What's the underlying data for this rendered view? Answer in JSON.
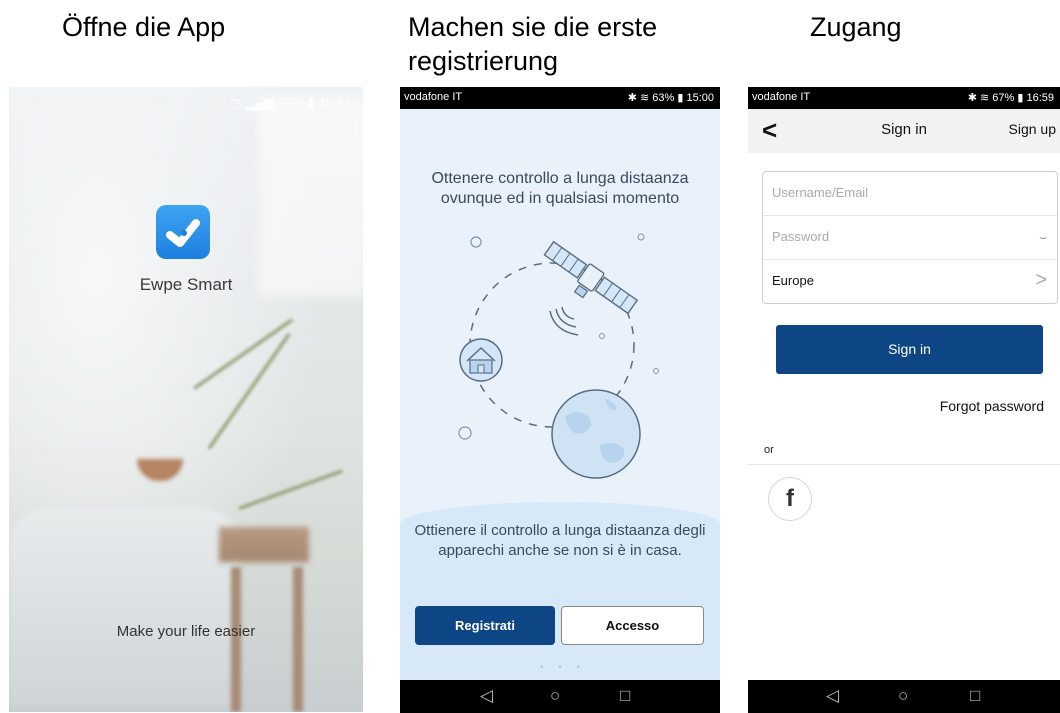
{
  "captions": {
    "open_app": "Öffne die App",
    "first_registration": "Machen sie die erste registrierung",
    "access": "Zugang"
  },
  "splash": {
    "status": {
      "battery": "77%",
      "time": "15:51"
    },
    "app_name": "Ewpe Smart",
    "tagline": "Make your life easier"
  },
  "onboarding": {
    "status": {
      "carrier": "vodafone IT",
      "battery": "63%",
      "time": "15:00"
    },
    "heading": "Ottenere controllo a lunga distaanza ovunque ed in qualsiasi momento",
    "description": "Ottienere il controllo a lunga distaanza degli apparechi anche se non si è in casa.",
    "register_button": "Registrati",
    "login_button": "Accesso",
    "page_indicator": "• • •"
  },
  "signin": {
    "status": {
      "carrier": "vodafone IT",
      "battery": "67%",
      "time": "16:59"
    },
    "title": "Sign in",
    "signup_link": "Sign up",
    "username_placeholder": "Username/Email",
    "password_placeholder": "Password",
    "region_value": "Europe",
    "signin_button": "Sign in",
    "forgot_link": "Forgot password",
    "or_label": "or"
  },
  "colors": {
    "primary_blue": "#0d4585",
    "app_icon_blue": "#2a8ef0",
    "illustration_blue": "#d4e7f8"
  }
}
